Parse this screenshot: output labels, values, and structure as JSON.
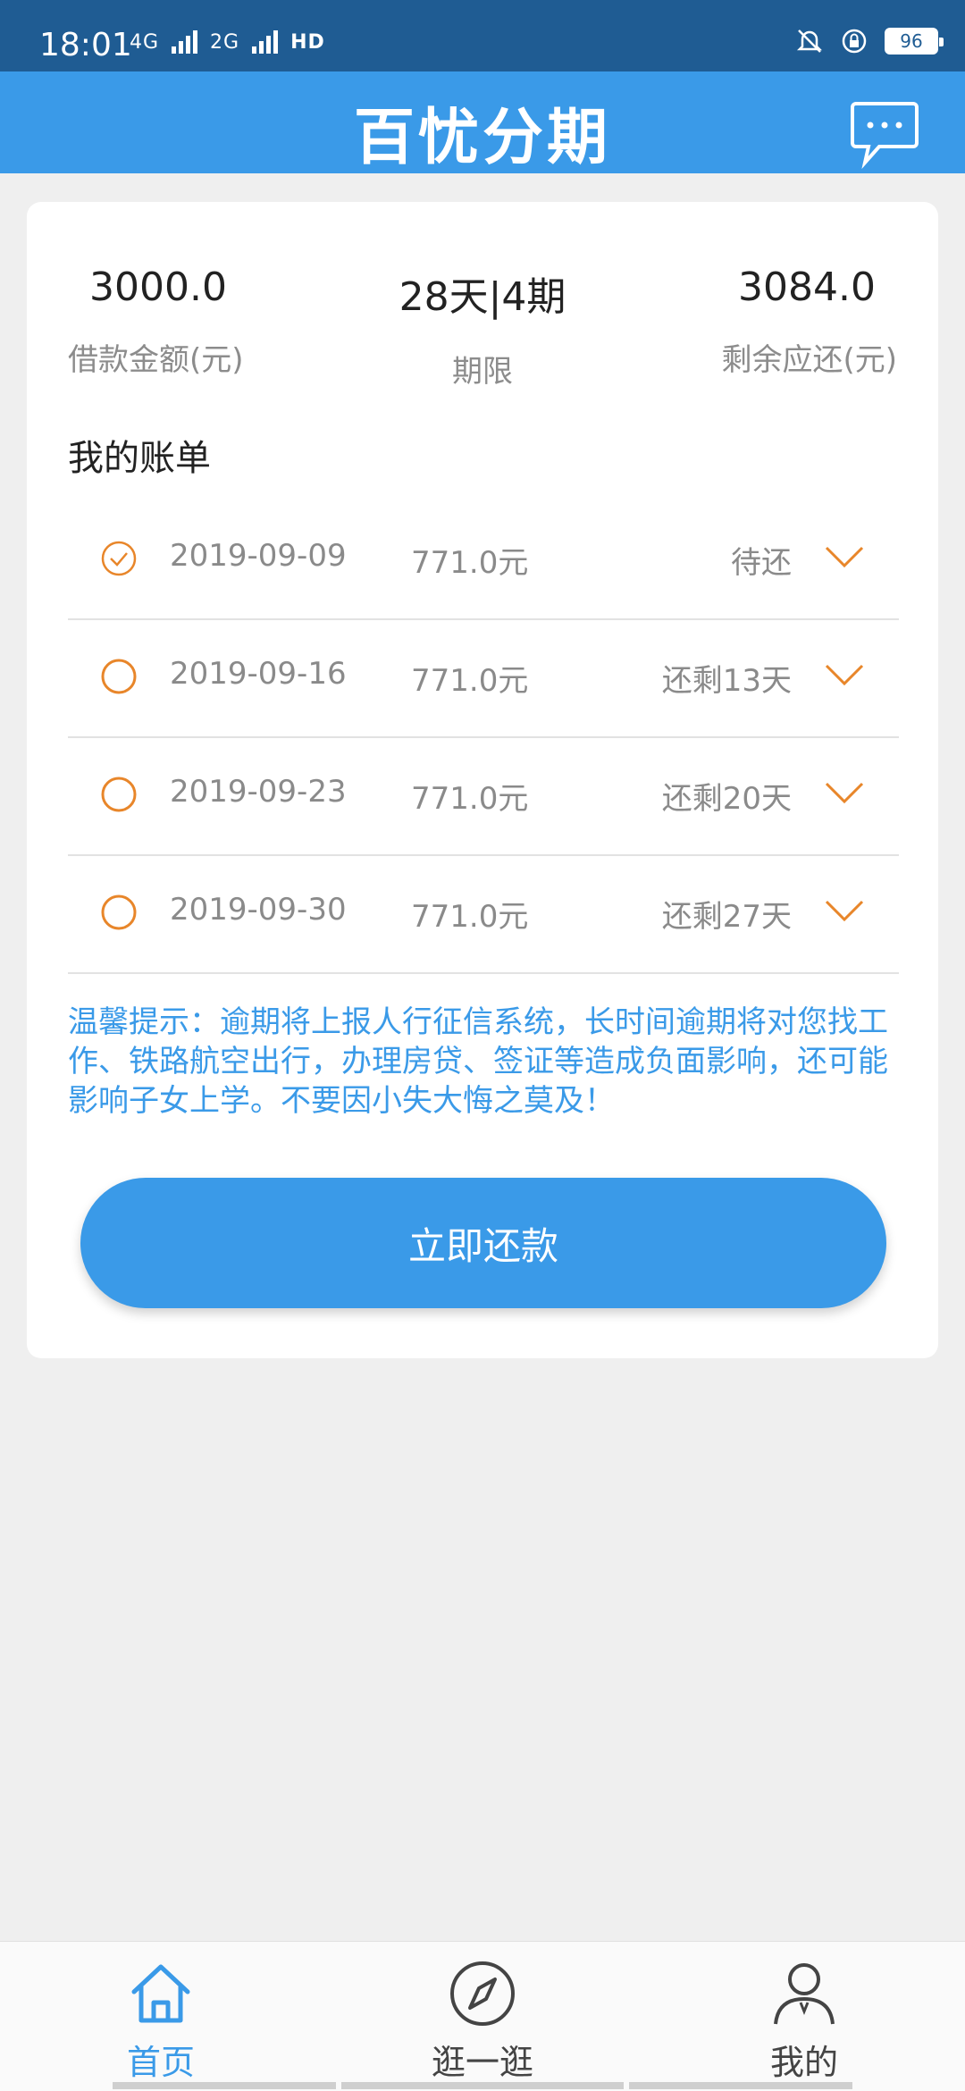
{
  "status_bar": {
    "time": "18:01",
    "net1": "4G",
    "net2": "2G",
    "hd": "HD",
    "battery": "96"
  },
  "header": {
    "title": "百忧分期",
    "chat_icon": "chat-bubble-icon"
  },
  "summary": {
    "amount_value": "3000.0",
    "amount_label": "借款金额(元)",
    "term_value": "28天|4期",
    "term_label": "期限",
    "remaining_value": "3084.0",
    "remaining_label": "剩余应还(元)"
  },
  "bills": {
    "title": "我的账单",
    "items": [
      {
        "date": "2019-09-09",
        "amount": "771.0元",
        "status": "待还",
        "checked": true
      },
      {
        "date": "2019-09-16",
        "amount": "771.0元",
        "status": "还剩13天",
        "checked": false
      },
      {
        "date": "2019-09-23",
        "amount": "771.0元",
        "status": "还剩20天",
        "checked": false
      },
      {
        "date": "2019-09-30",
        "amount": "771.0元",
        "status": "还剩27天",
        "checked": false
      }
    ]
  },
  "tip": "温馨提示：逾期将上报人行征信系统，长时间逾期将对您找工作、铁路航空出行，办理房贷、签证等造成负面影响，还可能影响子女上学。不要因小失大悔之莫及！",
  "pay_button": "立即还款",
  "nav": {
    "home": "首页",
    "explore": "逛一逛",
    "mine": "我的"
  },
  "colors": {
    "primary": "#3a9ae8",
    "status_bar": "#1f5c93",
    "accent_orange": "#e8862a"
  }
}
